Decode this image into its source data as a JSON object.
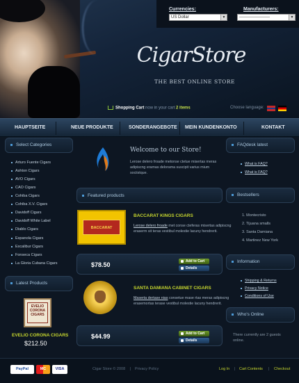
{
  "header": {
    "currencies_label": "Currencies:",
    "currency_value": "US Dollar",
    "manufacturers_label": "Manufacturers:",
    "manufacturer_value": "----------------------",
    "logo_text": "CigarStore",
    "tagline": "THE BEST ONLINE STORE",
    "cart_label": "Shopping Cart",
    "cart_prefix": "now in your cart",
    "cart_count": "2 items",
    "language_label": "Choose language:"
  },
  "nav": {
    "items": [
      "HAUPTSEITE",
      "NEUE PRODUKTE",
      "SONDERANGEBOTE",
      "MEIN KUNDENKONTO",
      "KONTAKT"
    ]
  },
  "categories": {
    "title": "Select Categories",
    "items": [
      "Arturo Fuente Cigars",
      "Ashton Cigars",
      "AVO Cigars",
      "CAO Cigars",
      "Cohiba Cigars",
      "Cohiba X.V. Cigars",
      "Davidoff Cigars",
      "Davidoff White Label",
      "Diablo Cigars",
      "Espanola Cigars",
      "Excalibur Cigars",
      "Fonseca Cigars",
      "La Gloria Cubana Cigars"
    ]
  },
  "latest": {
    "title": "Latest Products",
    "name": "EVELIO CORONA CIGARS",
    "price": "$212.50"
  },
  "welcome": {
    "title": "Welcome to our Store!",
    "text": "Lerose delero froade metonse ctetue misertas meras adipiscng eramas delorama suscipit varius mium sociistque."
  },
  "featured": {
    "title": "Featured products",
    "products": [
      {
        "name": "BACCARAT KINGS CIGARS",
        "link": "Lerose delero froade",
        "text": " met conse cteferas misertas adipiscng eraserm sit teras vestibul molestie lacuny hendrerit.",
        "price": "$78.50",
        "add": "Add to Cart",
        "details": "Details"
      },
      {
        "name": "SANTA DAMIANA CABINET CIGARS",
        "link": "Maserta dertase nias",
        "text": " consetue mase rtas meras adipiscng erasemortas terase vestibul molestie lacuny hendrerit.",
        "price": "$44.99",
        "add": "Add to Cart",
        "details": "Details"
      }
    ]
  },
  "faq": {
    "title": "FAQdesk latest",
    "items": [
      "What is FAQ?",
      "What is FAQ?"
    ]
  },
  "bestsellers": {
    "title": "Bestsellers",
    "items": [
      "1. Montecristo",
      "2. Tijuana smalls",
      "3. Santa Damiana",
      "4. Martinez New York"
    ]
  },
  "information": {
    "title": "Information",
    "items": [
      "Shipping & Returns",
      "Privacy Notice",
      "Conditions of Use"
    ]
  },
  "whos_online": {
    "title": "Who's Online",
    "text": "There currently are 2 guests online."
  },
  "footer": {
    "copyright": "Cigar Store © 2008",
    "privacy": "Privacy Policy",
    "links": [
      "Log In",
      "Cart Contents",
      "Checkout"
    ],
    "payments": [
      "PayPal",
      "MC",
      "VISA"
    ]
  },
  "colors": {
    "accent": "#c6d62e",
    "background": "#0d1622",
    "nav": "#1f3449"
  }
}
